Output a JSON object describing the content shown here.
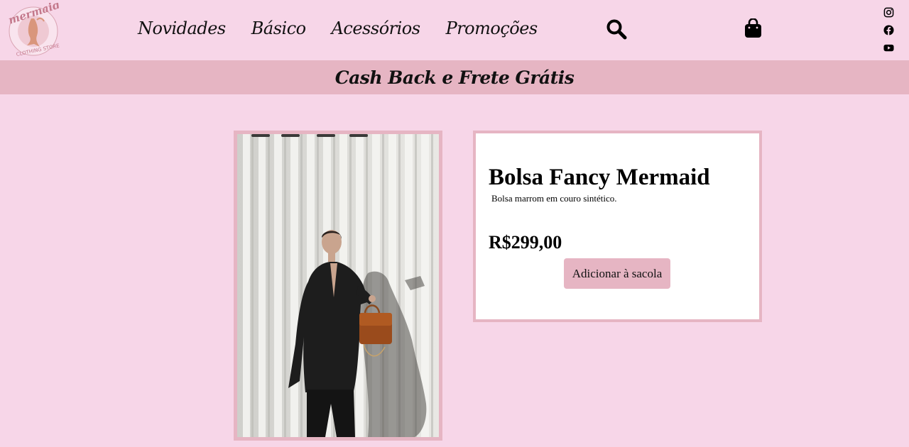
{
  "brand": {
    "logo_text": "mermaid",
    "logo_subtext": "CLOTHING STORE"
  },
  "nav": {
    "items": [
      {
        "label": "Novidades"
      },
      {
        "label": "Básico"
      },
      {
        "label": "Acessórios"
      },
      {
        "label": "Promoções"
      }
    ]
  },
  "icons": {
    "search": "search-icon",
    "bag": "shopping-bag-icon",
    "social": [
      "instagram-icon",
      "facebook-icon",
      "youtube-icon"
    ]
  },
  "banner": {
    "text": "Cash Back e Frete Grátis"
  },
  "product": {
    "title": "Bolsa Fancy Mermaid",
    "description": "Bolsa marrom em couro sintético.",
    "price": "R$299,00",
    "add_button_label": "Adicionar à sacola"
  },
  "colors": {
    "background": "#f7d6e8",
    "accent": "#e6b5c3",
    "card": "#ffffff",
    "text": "#111111"
  }
}
